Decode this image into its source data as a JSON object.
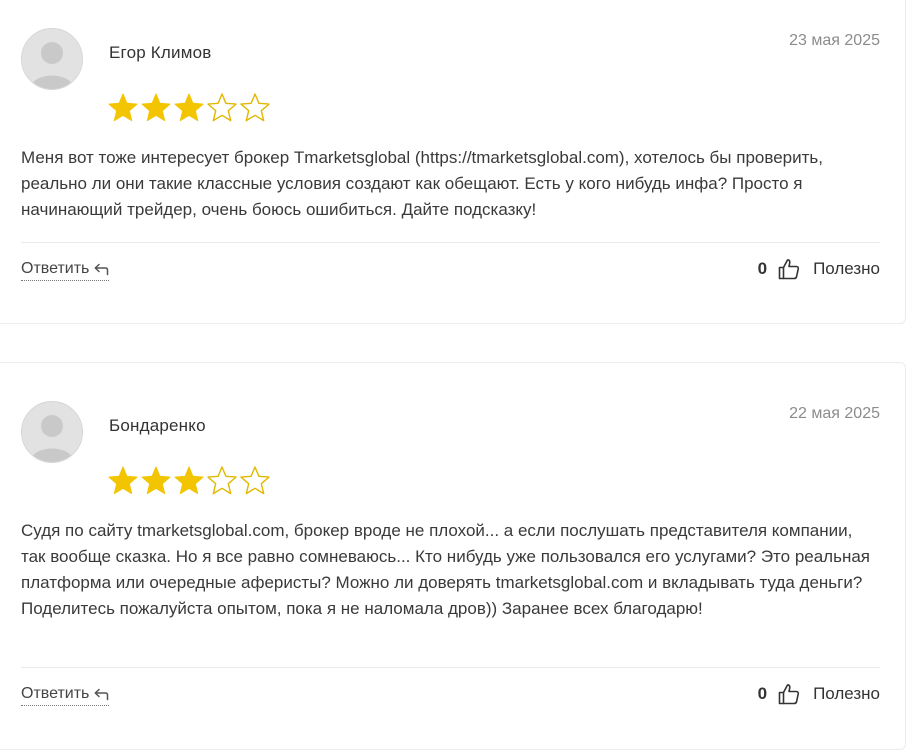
{
  "colors": {
    "star_filled": "#F2C500",
    "star_empty_outline": "#E2B800",
    "date_text": "#8C8C8C",
    "card_border": "#ECECEC"
  },
  "reviews": [
    {
      "author": "Егор Климов",
      "date": "23 мая 2025",
      "rating": 3,
      "rating_max": 5,
      "text": "Меня вот тоже интересует брокер Tmarketsglobal (https://tmarketsglobal.com), хотелось бы проверить, реально ли они такие классные условия создают как обещают. Есть у кого нибудь инфа? Просто я начинающий трейдер, очень боюсь ошибиться. Дайте подсказку!",
      "reply_label": "Ответить",
      "reply_icon": "reply-arrow-icon",
      "likes": "0",
      "helpful_icon": "thumbs-up-icon",
      "helpful_label": "Полезно"
    },
    {
      "author": "Бондаренко",
      "date": "22 мая 2025",
      "rating": 3,
      "rating_max": 5,
      "text": "Судя по сайту tmarketsglobal.com, брокер вроде не плохой... а если послушать представителя компании, так вообще сказка. Но я все равно сомневаюсь... Кто нибудь уже пользовался его услугами? Это реальная платформа или очередные аферисты? Можно ли доверять tmarketsglobal.com и вкладывать туда деньги? Поделитесь пожалуйста опытом, пока я не наломала дров)) Заранее всех благодарю!",
      "reply_label": "Ответить",
      "reply_icon": "reply-arrow-icon",
      "likes": "0",
      "helpful_icon": "thumbs-up-icon",
      "helpful_label": "Полезно"
    }
  ]
}
